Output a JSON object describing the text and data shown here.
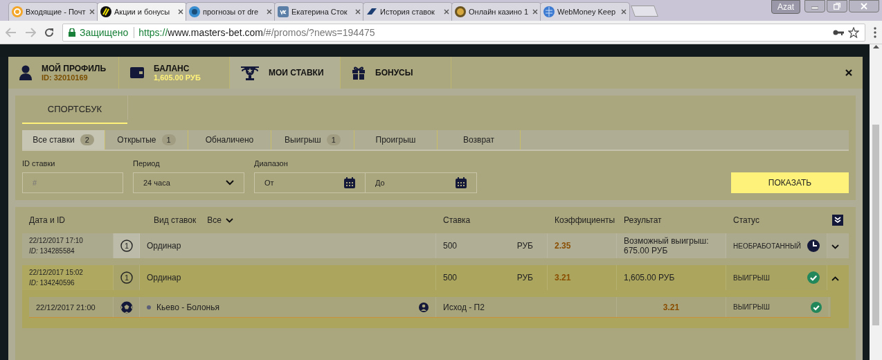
{
  "browser": {
    "tabs": [
      {
        "title": "Входящие - Почт",
        "selected": false
      },
      {
        "title": "Акции и бонусы",
        "selected": true
      },
      {
        "title": "прогнозы от dre",
        "selected": false
      },
      {
        "title": "Екатерина Сток",
        "selected": false
      },
      {
        "title": "История ставок",
        "selected": false
      },
      {
        "title": "Онлайн казино 1",
        "selected": false
      },
      {
        "title": "WebMoney Keep",
        "selected": false
      }
    ],
    "profile": "Azat",
    "address": {
      "security": "Защищено",
      "scheme": "https://",
      "host": "www.masters-bet.com",
      "path": "/#/promos/?news=194475"
    }
  },
  "modal": {
    "header_tabs": [
      {
        "kind": "profile",
        "title": "МОЙ ПРОФИЛЬ",
        "subtitle": "ID: 32010169",
        "selected": false
      },
      {
        "kind": "balance",
        "title": "БАЛАНС",
        "subtitle": "1,605.00 РУБ",
        "selected": false
      },
      {
        "kind": "bets",
        "title": "МОИ СТАВКИ",
        "selected": true
      },
      {
        "kind": "bonus",
        "title": "БОНУСЫ",
        "selected": false
      }
    ],
    "section_tab": {
      "label": "СПОРТСБУК",
      "selected": true
    },
    "filter_tabs": [
      {
        "label": "Все ставки",
        "count": "2",
        "selected": true
      },
      {
        "label": "Открытые",
        "count": "1",
        "selected": false
      },
      {
        "label": "Обналичено",
        "selected": false
      },
      {
        "label": "Выигрыш",
        "count": "1",
        "selected": false
      },
      {
        "label": "Проигрыш",
        "selected": false
      },
      {
        "label": "Возврат",
        "selected": false
      }
    ],
    "filters": {
      "bet_id": {
        "label": "ID ставки",
        "placeholder": "#"
      },
      "period": {
        "label": "Период",
        "value": "24 часа"
      },
      "range": {
        "label": "Диапазон",
        "from": "От",
        "to": "До"
      }
    },
    "show_button": "ПОКАЗАТЬ",
    "table": {
      "columns": [
        "Дата и ID",
        "Вид ставок",
        "Ставка",
        "Коэффициенты",
        "Результат",
        "Статус"
      ],
      "type_filter": "Все",
      "rows": [
        {
          "date": "22/12/2017 17:10",
          "id_label": "ID:",
          "id": "134285584",
          "count": "1",
          "type": "Ординар",
          "stake": "500",
          "currency": "РУБ",
          "odds": "2.35",
          "result": "Возможный выигрыш: 675.00 РУБ",
          "status": "НЕОБРАБОТАННЫЙ",
          "kind": "pending",
          "expanded": false
        },
        {
          "date": "22/12/2017 15:02",
          "id_label": "ID:",
          "id": "134240596",
          "count": "1",
          "type": "Ординар",
          "stake": "500",
          "currency": "РУБ",
          "odds": "3.21",
          "result": "1,605.00 РУБ",
          "status": "ВЫИГРЫШ",
          "kind": "won",
          "expanded": true,
          "events": [
            {
              "date": "22/12/2017 21:00",
              "event": "Кьево - Болонья",
              "outcome": "Исход - П2",
              "odds": "3.21",
              "status": "ВЫИГРЫШ",
              "kind": "won"
            }
          ]
        }
      ]
    }
  }
}
